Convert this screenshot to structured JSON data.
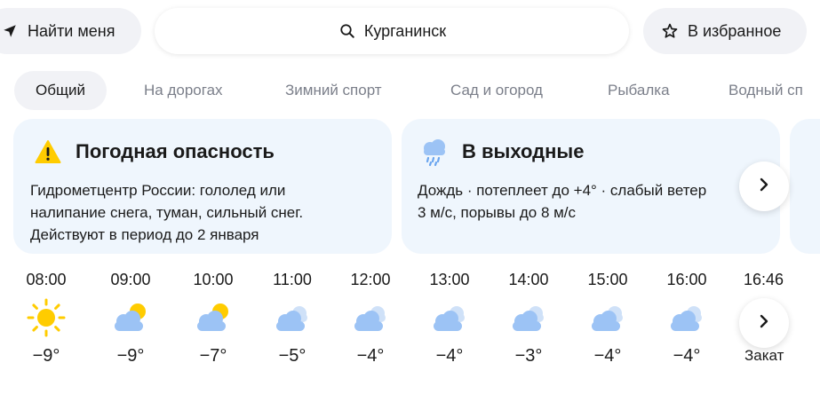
{
  "header": {
    "locate_label": "Найти меня",
    "search_value": "Курганинск",
    "favorite_label": "В избранное"
  },
  "tabs": [
    {
      "label": "Общий",
      "active": true
    },
    {
      "label": "На дорогах"
    },
    {
      "label": "Зимний спорт"
    },
    {
      "label": "Сад и огород"
    },
    {
      "label": "Рыбалка"
    },
    {
      "label": "Водный сп"
    }
  ],
  "cards": {
    "warning": {
      "icon": "warning-icon",
      "title": "Погодная опасность",
      "lines": [
        "Гидрометцентр России: гололед или",
        "налипание снега, туман, сильный снег.",
        "Действуют в период до 2 января"
      ]
    },
    "weekend": {
      "icon": "rain-cloud-icon",
      "title": "В выходные",
      "lines": [
        "Дождь · потеплеет до +4° · слабый ветер",
        "3 м/с, порывы до 8 м/с"
      ]
    }
  },
  "hourly": [
    {
      "time": "08:00",
      "icon": "sun-icon",
      "temp": "−9°"
    },
    {
      "time": "09:00",
      "icon": "partly-cloudy-icon",
      "temp": "−9°"
    },
    {
      "time": "10:00",
      "icon": "partly-cloudy-icon",
      "temp": "−7°"
    },
    {
      "time": "11:00",
      "icon": "cloudy-icon",
      "temp": "−5°"
    },
    {
      "time": "12:00",
      "icon": "cloudy-icon",
      "temp": "−4°"
    },
    {
      "time": "13:00",
      "icon": "cloudy-icon",
      "temp": "−4°"
    },
    {
      "time": "14:00",
      "icon": "cloudy-icon",
      "temp": "−3°"
    },
    {
      "time": "15:00",
      "icon": "cloudy-icon",
      "temp": "−4°"
    },
    {
      "time": "16:00",
      "icon": "cloudy-icon",
      "temp": "−4°"
    },
    {
      "time": "16:46",
      "icon": "sunset-icon",
      "temp": "Закат"
    }
  ],
  "colors": {
    "accent_yellow": "#ffcc00",
    "cloud_blue": "#9cc3f5",
    "card_bg": "#eff6fd",
    "pill_bg": "#f1f2f6"
  }
}
